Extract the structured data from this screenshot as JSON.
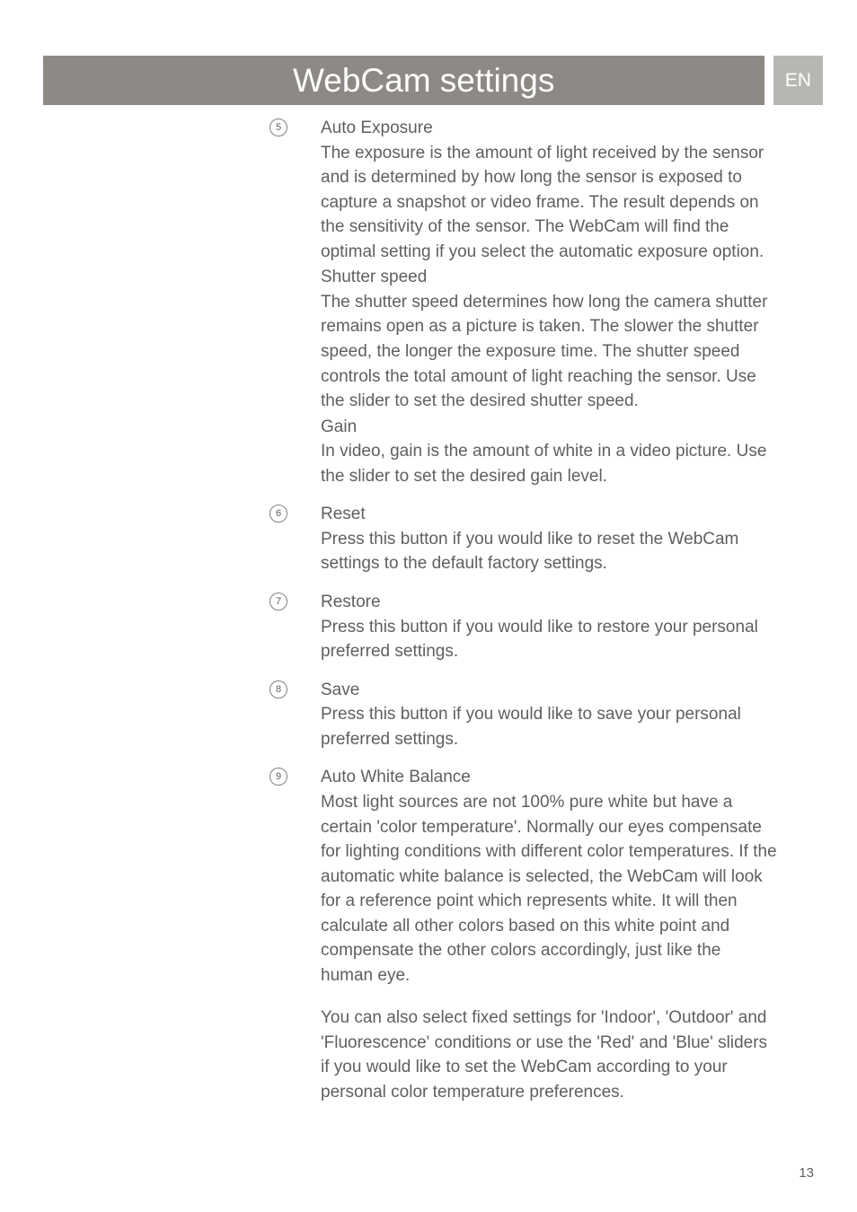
{
  "header": {
    "title": "WebCam settings",
    "lang": "EN"
  },
  "items": [
    {
      "num": "5",
      "title": "Auto Exposure",
      "para1": "The exposure is the amount of light received by the sensor and is determined by how long the sensor is exposed to capture a snapshot or video frame. The result depends on the sensitivity of the sensor. The WebCam will find the optimal setting if you select the automatic exposure option.",
      "sub1_title": "Shutter speed",
      "sub1_para": "The shutter speed determines how long the camera shutter remains open as a picture is taken. The slower the shutter speed, the longer the exposure time. The shutter speed controls the total amount of light reaching the sensor. Use the slider to set the desired shutter speed.",
      "sub2_title": "Gain",
      "sub2_para": "In video, gain is the amount of white in a video picture. Use the slider to set the desired gain level."
    },
    {
      "num": "6",
      "title": "Reset",
      "para1": "Press this button if you would like to reset the WebCam settings to the default factory settings."
    },
    {
      "num": "7",
      "title": "Restore",
      "para1": "Press this button if you would like to restore your personal preferred settings."
    },
    {
      "num": "8",
      "title": "Save",
      "para1": "Press this button if you would like to save your personal preferred settings."
    },
    {
      "num": "9",
      "title": "Auto White Balance",
      "para1": "Most light sources are not 100% pure white but have a certain 'color temperature'. Normally our eyes compensate for lighting conditions with different color temperatures. If the automatic white balance is selected, the WebCam will look for a reference point which represents white. It will then calculate all other colors based on this white point and compensate the other colors accordingly, just like the human eye.",
      "para2": "You can also select fixed settings for 'Indoor', 'Outdoor' and 'Fluorescence' conditions or use the 'Red' and 'Blue' sliders if you would like to set the WebCam according to your personal color temperature preferences."
    }
  ],
  "page_number": "13"
}
